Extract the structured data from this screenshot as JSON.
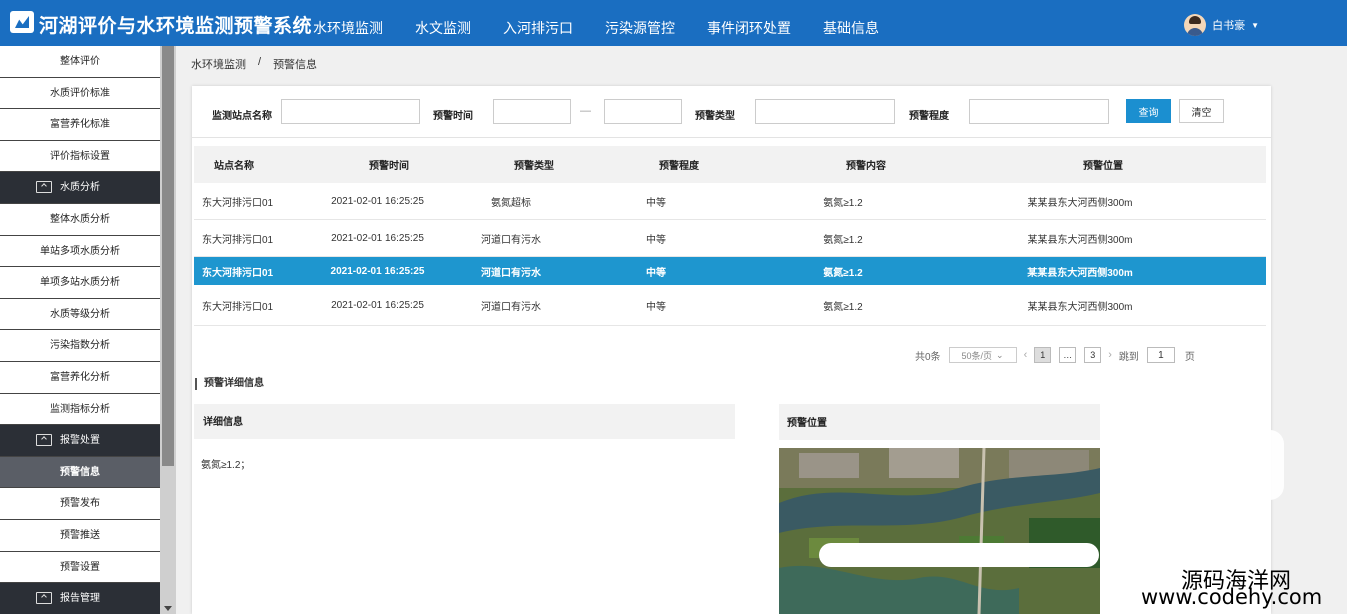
{
  "header": {
    "title": "河湖评价与水环境监测预警系统",
    "nav": [
      "水环境监测",
      "水文监测",
      "入河排污口",
      "污染源管控",
      "事件闭环处置",
      "基础信息"
    ],
    "user": "白书豪"
  },
  "sidebar": {
    "items": [
      {
        "type": "item",
        "label": "整体评价"
      },
      {
        "type": "item",
        "label": "水质评价标准"
      },
      {
        "type": "item",
        "label": "富营养化标准"
      },
      {
        "type": "item",
        "label": "评价指标设置"
      },
      {
        "type": "group",
        "label": "水质分析"
      },
      {
        "type": "item",
        "label": "整体水质分析"
      },
      {
        "type": "item",
        "label": "单站多项水质分析"
      },
      {
        "type": "item",
        "label": "单项多站水质分析"
      },
      {
        "type": "item",
        "label": "水质等级分析"
      },
      {
        "type": "item",
        "label": "污染指数分析"
      },
      {
        "type": "item",
        "label": "富营养化分析"
      },
      {
        "type": "item",
        "label": "监测指标分析"
      },
      {
        "type": "group",
        "label": "报警处置"
      },
      {
        "type": "item",
        "label": "预警信息",
        "active": true
      },
      {
        "type": "item",
        "label": "预警发布"
      },
      {
        "type": "item",
        "label": "预警推送"
      },
      {
        "type": "item",
        "label": "预警设置"
      },
      {
        "type": "group",
        "label": "报告管理"
      }
    ]
  },
  "breadcrumb": {
    "root": "水环境监测",
    "sep": "/",
    "current": "预警信息"
  },
  "filter": {
    "station_label": "监测站点名称",
    "time_label": "预警时间",
    "time_sep": "—",
    "type_label": "预警类型",
    "level_label": "预警程度",
    "query": "查询",
    "clear": "清空"
  },
  "table": {
    "headers": [
      "站点名称",
      "预警时间",
      "预警类型",
      "预警程度",
      "预警内容",
      "预警位置"
    ],
    "rows": [
      [
        "东大河排污口01",
        "2021-02-01   16:25:25",
        "氨氮超标",
        "中等",
        "氨氮≥1.2",
        "某某县东大河西侧300m"
      ],
      [
        "东大河排污口01",
        "2021-02-01   16:25:25",
        "河道口有污水",
        "中等",
        "氨氮≥1.2",
        "某某县东大河西侧300m"
      ],
      [
        "东大河排污口01",
        "2021-02-01   16:25:25",
        "河道口有污水",
        "中等",
        "氨氮≥1.2",
        "某某县东大河西侧300m"
      ],
      [
        "东大河排污口01",
        "2021-02-01   16:25:25",
        "河道口有污水",
        "中等",
        "氨氮≥1.2",
        "某某县东大河西侧300m"
      ]
    ],
    "selected_row": 2
  },
  "pager": {
    "total": "共0条",
    "page_size": "50条/页",
    "prev": "‹",
    "page_first": "1",
    "ellipsis": "…",
    "page_last": "3",
    "next": "›",
    "jump_label": "跳到",
    "jump_value": "1",
    "page_unit": "页"
  },
  "detail": {
    "section_title": "预警详细信息",
    "info_title": "详细信息",
    "info_text": "氨氮≥1.2；",
    "location_title": "预警位置"
  },
  "watermark": {
    "cn": "源码海洋网",
    "en": "www.codehy.com"
  }
}
